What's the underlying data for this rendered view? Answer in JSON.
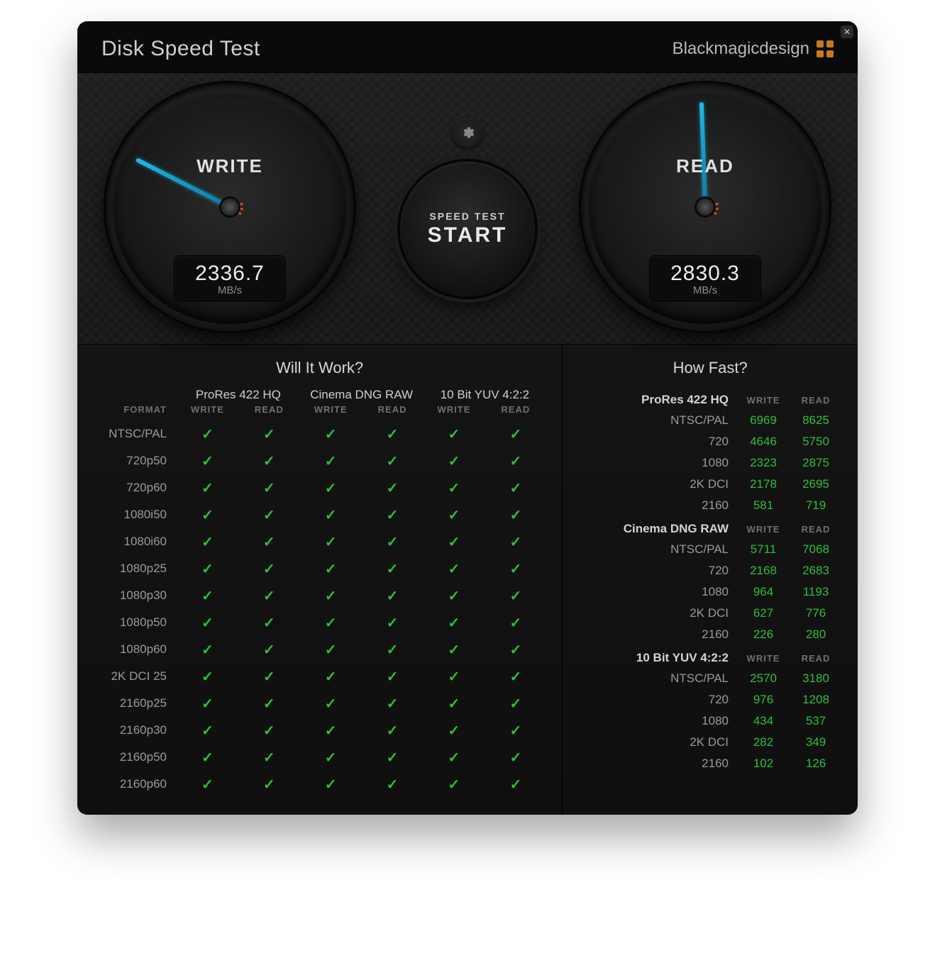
{
  "app": {
    "title": "Disk Speed Test",
    "brand": "Blackmagicdesign"
  },
  "start": {
    "top": "SPEED TEST",
    "label": "START"
  },
  "gauges": {
    "write": {
      "label": "WRITE",
      "value": "2336.7",
      "unit": "MB/s",
      "needle_deg": -63
    },
    "read": {
      "label": "READ",
      "value": "2830.3",
      "unit": "MB/s",
      "needle_deg": -2
    }
  },
  "labels": {
    "will_it_work": "Will It Work?",
    "how_fast": "How Fast?",
    "format": "FORMAT",
    "write": "WRITE",
    "read": "READ"
  },
  "codecs": [
    "ProRes 422 HQ",
    "Cinema DNG RAW",
    "10 Bit YUV 4:2:2"
  ],
  "formats": [
    "NTSC/PAL",
    "720p50",
    "720p60",
    "1080i50",
    "1080i60",
    "1080p25",
    "1080p30",
    "1080p50",
    "1080p60",
    "2K DCI 25",
    "2160p25",
    "2160p30",
    "2160p50",
    "2160p60"
  ],
  "wiw_all_pass": true,
  "howfast": [
    {
      "codec": "ProRes 422 HQ",
      "rows": [
        {
          "label": "NTSC/PAL",
          "write": 6969,
          "read": 8625
        },
        {
          "label": "720",
          "write": 4646,
          "read": 5750
        },
        {
          "label": "1080",
          "write": 2323,
          "read": 2875
        },
        {
          "label": "2K DCI",
          "write": 2178,
          "read": 2695
        },
        {
          "label": "2160",
          "write": 581,
          "read": 719
        }
      ]
    },
    {
      "codec": "Cinema DNG RAW",
      "rows": [
        {
          "label": "NTSC/PAL",
          "write": 5711,
          "read": 7068
        },
        {
          "label": "720",
          "write": 2168,
          "read": 2683
        },
        {
          "label": "1080",
          "write": 964,
          "read": 1193
        },
        {
          "label": "2K DCI",
          "write": 627,
          "read": 776
        },
        {
          "label": "2160",
          "write": 226,
          "read": 280
        }
      ]
    },
    {
      "codec": "10 Bit YUV 4:2:2",
      "rows": [
        {
          "label": "NTSC/PAL",
          "write": 2570,
          "read": 3180
        },
        {
          "label": "720",
          "write": 976,
          "read": 1208
        },
        {
          "label": "1080",
          "write": 434,
          "read": 537
        },
        {
          "label": "2K DCI",
          "write": 282,
          "read": 349
        },
        {
          "label": "2160",
          "write": 102,
          "read": 126
        }
      ]
    }
  ]
}
